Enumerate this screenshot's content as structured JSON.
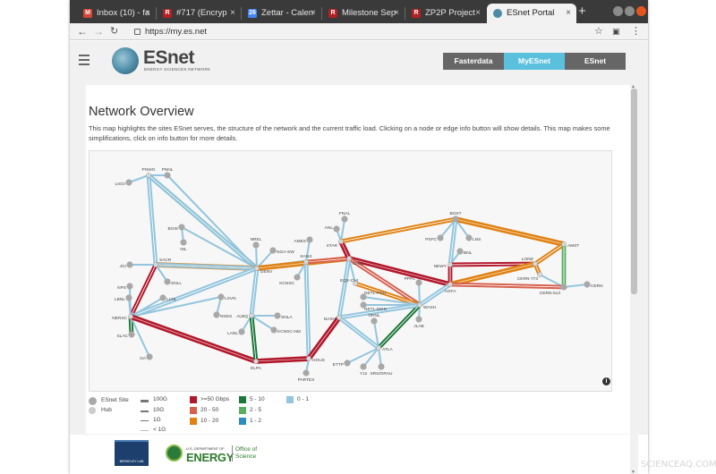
{
  "browser": {
    "tabs": [
      {
        "title": "Inbox (10) - fa",
        "favicon": "gmail-icon",
        "favicon_glyph": "M",
        "color": "#d44638"
      },
      {
        "title": "#717 (Encryp",
        "favicon": "redmine-icon",
        "favicon_glyph": "R",
        "color": "#b32024"
      },
      {
        "title": "Zettar - Calen",
        "favicon": "calendar-icon",
        "favicon_glyph": "26",
        "color": "#4285f4"
      },
      {
        "title": "Milestone Sep",
        "favicon": "redmine-icon",
        "favicon_glyph": "R",
        "color": "#b32024"
      },
      {
        "title": "ZP2P Project",
        "favicon": "redmine-icon",
        "favicon_glyph": "R",
        "color": "#b32024"
      },
      {
        "title": "ESnet Portal",
        "favicon": "esnet-icon",
        "favicon_glyph": "",
        "color": "#4d8ca6"
      }
    ],
    "new_tab": "+",
    "url": "https://my.es.net"
  },
  "header": {
    "logo_text": "ESnet",
    "logo_sub": "ENERGY SCIENCES NETWORK",
    "nav": [
      {
        "label": "Fasterdata",
        "color": "#666666"
      },
      {
        "label": "MyESnet",
        "color": "#5bc0de"
      },
      {
        "label": "ESnet",
        "color": "#666666"
      }
    ]
  },
  "page": {
    "title": "Network Overview",
    "description": "This map highlights the sites ESnet serves, the structure of the network and the current traffic load. Clicking on a node or edge info button will show details. This map makes some simplifications, click on info button for more details."
  },
  "map": {
    "nodes": [
      "LIGO",
      "PNWG",
      "PNNL",
      "BOIS",
      "INL",
      "JGI",
      "SACR",
      "SNLL",
      "NPS",
      "LBNL",
      "LLNL",
      "NERSC",
      "SLAC",
      "GA",
      "NREL",
      "NGA-SW",
      "DENV",
      "LSVN",
      "NNSS",
      "ALBQ",
      "SNLA",
      "LANL",
      "KCNSC-NM",
      "ELPA",
      "AMES",
      "KANS",
      "KCNSC",
      "FNAL",
      "ANL",
      "STAR",
      "CHIC",
      "BOST",
      "PSFC",
      "LNS",
      "BNL",
      "AMST",
      "NEWY",
      "LOND",
      "CERN-773",
      "CERN-513",
      "CERN",
      "AOFA",
      "PPPL",
      "WASH",
      "JLAB",
      "NETL-PGH",
      "NETL-MGN",
      "ORNL",
      "ATLA",
      "ETTP",
      "Y12",
      "SRS/ORAU",
      "NASH",
      "HOUS",
      "PARTEX",
      "EQX-CHI"
    ],
    "info": "i"
  },
  "legend": {
    "site_label": "ESnet Site",
    "hub_label": "Hub",
    "capacities": [
      "100G",
      "10G",
      "1G",
      "< 1G"
    ],
    "loads": [
      {
        "label": ">=50 Gbps",
        "color": "#b2182b"
      },
      {
        "label": "20 - 50",
        "color": "#d6604d"
      },
      {
        "label": "10 - 20",
        "color": "#e08214"
      },
      {
        "label": "5 - 10",
        "color": "#1b7837"
      },
      {
        "label": "2 - 5",
        "color": "#5aae61"
      },
      {
        "label": "1 - 2",
        "color": "#2b8cbe"
      },
      {
        "label": "0 - 1",
        "color": "#92c5de"
      }
    ]
  },
  "footer": {
    "lab": "BERKELEY LAB",
    "doe_top": "U.S. DEPARTMENT OF",
    "doe_big": "ENERGY",
    "office": [
      "Office of",
      "Science"
    ]
  }
}
